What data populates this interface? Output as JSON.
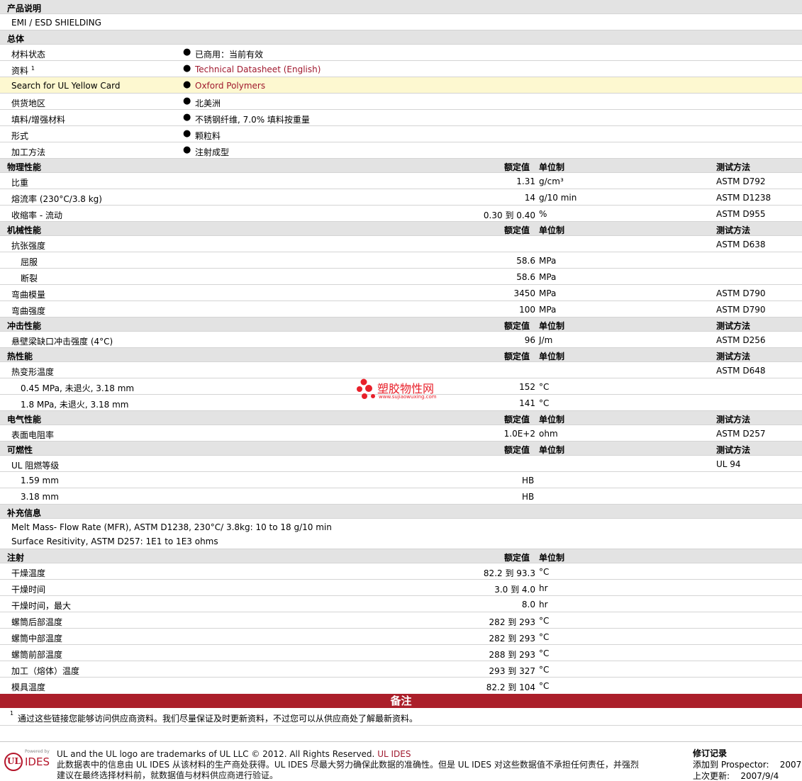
{
  "description": {
    "header": "产品说明",
    "text": "EMI / ESD SHIELDING"
  },
  "general": {
    "header": "总体",
    "rows": [
      {
        "label": "材料状态",
        "value": "已商用：当前有效"
      },
      {
        "label": "资料",
        "sup": "1",
        "value": "Technical Datasheet (English)"
      },
      {
        "label": "Search for UL Yellow Card",
        "value": "Oxford Polymers"
      },
      {
        "label": "供货地区",
        "value": "北美洲"
      },
      {
        "label": "填料/增强材料",
        "value": "不锈钢纤维, 7.0% 填料按重量"
      },
      {
        "label": "形式",
        "value": "颗粒料"
      },
      {
        "label": "加工方法",
        "value": "注射成型"
      }
    ]
  },
  "col_headers": {
    "value": "额定值",
    "unit": "单位制",
    "method": "测试方法"
  },
  "physical": {
    "header": "物理性能",
    "rows": [
      {
        "label": "比重",
        "value": "1.31",
        "unit": "g/cm³",
        "method": "ASTM D792"
      },
      {
        "label": "熔流率  (230°C/3.8 kg)",
        "value": "14",
        "unit": "g/10 min",
        "method": "ASTM D1238"
      },
      {
        "label": "收缩率  - 流动",
        "value": "0.30 到  0.40",
        "unit": "%",
        "method": "ASTM D955"
      }
    ]
  },
  "mechanical": {
    "header": "机械性能",
    "rows": [
      {
        "label": "抗张强度",
        "value": "",
        "unit": "",
        "method": "ASTM D638"
      },
      {
        "label": "屈服",
        "value": "58.6",
        "unit": "MPa",
        "method": ""
      },
      {
        "label": "断裂",
        "value": "58.6",
        "unit": "MPa",
        "method": ""
      },
      {
        "label": "弯曲模量",
        "value": "3450",
        "unit": "MPa",
        "method": "ASTM D790"
      },
      {
        "label": "弯曲强度",
        "value": "100",
        "unit": "MPa",
        "method": "ASTM D790"
      }
    ]
  },
  "impact": {
    "header": "冲击性能",
    "rows": [
      {
        "label": "悬壁梁缺口冲击强度  (4°C)",
        "value": "96",
        "unit": "J/m",
        "method": "ASTM D256"
      }
    ]
  },
  "thermal": {
    "header": "热性能",
    "rows": [
      {
        "label": "热变形温度",
        "value": "",
        "unit": "",
        "method": "ASTM D648"
      },
      {
        "label": "0.45 MPa, 未退火, 3.18 mm",
        "value": "152",
        "unit": "°C",
        "method": ""
      },
      {
        "label": "1.8 MPa, 未退火, 3.18 mm",
        "value": "141",
        "unit": "°C",
        "method": ""
      }
    ]
  },
  "electrical": {
    "header": "电气性能",
    "rows": [
      {
        "label": "表面电阻率",
        "value": "1.0E+2",
        "unit": "ohm",
        "method": "ASTM D257"
      }
    ]
  },
  "flammability": {
    "header": "可燃性",
    "rows": [
      {
        "label": "UL 阻燃等级",
        "value": "",
        "unit": "",
        "method": "UL 94"
      },
      {
        "label": "1.59 mm",
        "value": "HB",
        "unit": "",
        "method": ""
      },
      {
        "label": "3.18 mm",
        "value": "HB",
        "unit": "",
        "method": ""
      }
    ]
  },
  "supplemental": {
    "header": "补充信息",
    "line1": "Melt Mass- Flow Rate (MFR), ASTM D1238, 230°C/ 3.8kg: 10 to 18 g/10 min",
    "line2": "Surface Resitivity, ASTM D257: 1E1 to 1E3 ohms"
  },
  "injection": {
    "header": "注射",
    "rows": [
      {
        "label": "干燥温度",
        "value": "82.2 到  93.3",
        "unit": "°C"
      },
      {
        "label": "干燥时间",
        "value": "3.0 到  4.0",
        "unit": "hr"
      },
      {
        "label": "干燥时间，最大",
        "value": "8.0",
        "unit": "hr"
      },
      {
        "label": "螺筒后部温度",
        "value": "282 到  293",
        "unit": "°C"
      },
      {
        "label": "螺筒中部温度",
        "value": "282 到  293",
        "unit": "°C"
      },
      {
        "label": "螺筒前部温度",
        "value": "288 到  293",
        "unit": "°C"
      },
      {
        "label": "加工（熔体）温度",
        "value": "293 到  327",
        "unit": "°C"
      },
      {
        "label": "模具温度",
        "value": "82.2 到  104",
        "unit": "°C"
      }
    ]
  },
  "remarks": {
    "header": "备注",
    "sup": "1",
    "text": "通过这些链接您能够访问供应商资料。我们尽量保证及时更新资料，不过您可以从供应商处了解最新资料。"
  },
  "watermark": {
    "cn": "塑胶物性网",
    "url": "www.sujiaowuxing.com"
  },
  "footer": {
    "logo_ul": "UL",
    "logo_powered": "Powered by",
    "logo_ides": "IDES",
    "line1": "UL and the UL logo are trademarks of UL LLC © 2012. All Rights Reserved.",
    "line1_link": "UL IDES",
    "line2": "此数据表中的信息由  UL IDES 从该材料的生产商处获得。UL IDES 尽最大努力确保此数据的准确性。但是  UL IDES 对这些数据值不承担任何责任，并强烈",
    "line3": "建议在最终选择材料前，就数据值与材料供应商进行验证。",
    "rev_header": "修订记录",
    "rev_added_label": "添加到  Prospector:",
    "rev_added_value": "2007",
    "rev_updated_label": "上次更新:",
    "rev_updated_value": "2007/9/4"
  },
  "colors": {
    "link": "#a0192e",
    "header_bg": "#e3e3e3",
    "remarks_bg": "#ab1f2a",
    "highlight_bg": "#fdf8d0"
  }
}
